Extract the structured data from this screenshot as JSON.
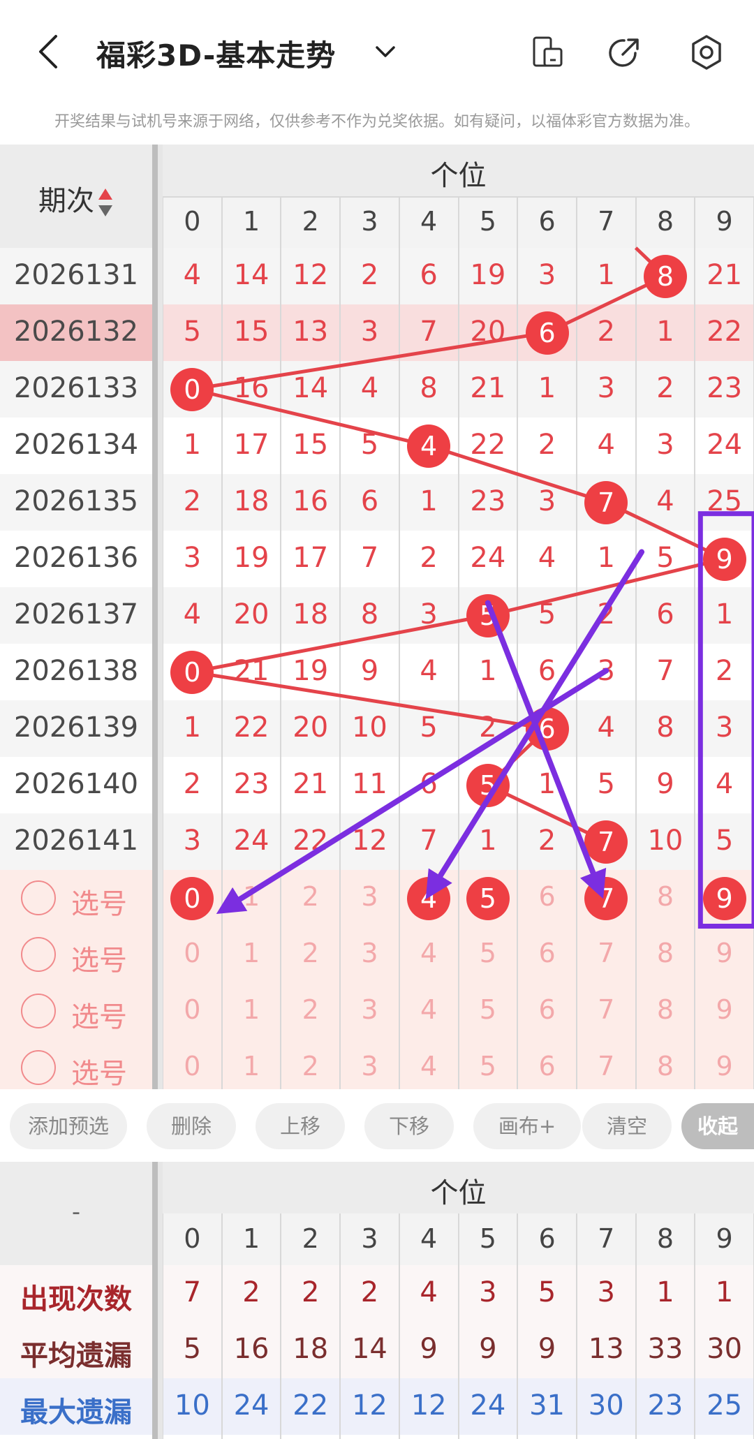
{
  "header": {
    "title": "福彩3D-基本走势",
    "back_icon": "chevron-left-icon",
    "title_dropdown_icon": "chevron-down-icon",
    "icons": [
      "phone-icon",
      "share-icon",
      "settings-icon"
    ]
  },
  "disclaimer": "开奖结果与试机号来源于网络，仅供参考不作为兑奖依据。如有疑问，以福体彩官方数据为准。",
  "grid": {
    "period_header": "期次",
    "section_title": "个位",
    "digits": [
      "0",
      "1",
      "2",
      "3",
      "4",
      "5",
      "6",
      "7",
      "8",
      "9"
    ],
    "rows": [
      {
        "period": "2026131",
        "cells": [
          "4",
          "14",
          "12",
          "2",
          "6",
          "19",
          "3",
          "1",
          "8",
          "21"
        ],
        "win": 8
      },
      {
        "period": "2026132",
        "cells": [
          "5",
          "15",
          "13",
          "3",
          "7",
          "20",
          "6",
          "2",
          "1",
          "22"
        ],
        "win": 6
      },
      {
        "period": "2026133",
        "cells": [
          "0",
          "16",
          "14",
          "4",
          "8",
          "21",
          "1",
          "3",
          "2",
          "23"
        ],
        "win": 0
      },
      {
        "period": "2026134",
        "cells": [
          "1",
          "17",
          "15",
          "5",
          "4",
          "22",
          "2",
          "4",
          "3",
          "24"
        ],
        "win": 4
      },
      {
        "period": "2026135",
        "cells": [
          "2",
          "18",
          "16",
          "6",
          "1",
          "23",
          "3",
          "7",
          "4",
          "25"
        ],
        "win": 7
      },
      {
        "period": "2026136",
        "cells": [
          "3",
          "19",
          "17",
          "7",
          "2",
          "24",
          "4",
          "1",
          "5",
          "9"
        ],
        "win": 9
      },
      {
        "period": "2026137",
        "cells": [
          "4",
          "20",
          "18",
          "8",
          "3",
          "5",
          "5",
          "2",
          "6",
          "1"
        ],
        "win": 5
      },
      {
        "period": "2026138",
        "cells": [
          "0",
          "21",
          "19",
          "9",
          "4",
          "1",
          "6",
          "3",
          "7",
          "2"
        ],
        "win": 0
      },
      {
        "period": "2026139",
        "cells": [
          "1",
          "22",
          "20",
          "10",
          "5",
          "2",
          "6",
          "4",
          "8",
          "3"
        ],
        "win": 6
      },
      {
        "period": "2026140",
        "cells": [
          "2",
          "23",
          "21",
          "11",
          "6",
          "5",
          "1",
          "5",
          "9",
          "4"
        ],
        "win": 5
      },
      {
        "period": "2026141",
        "cells": [
          "3",
          "24",
          "22",
          "12",
          "7",
          "1",
          "2",
          "7",
          "10",
          "5"
        ],
        "win": 7
      }
    ],
    "pick_label": "选号",
    "pick_rows": [
      {
        "selected": [
          0,
          4,
          5,
          7,
          9
        ]
      },
      {
        "selected": []
      },
      {
        "selected": []
      },
      {
        "selected": []
      }
    ]
  },
  "toolbar": {
    "buttons": [
      "添加预选",
      "删除",
      "上移",
      "下移",
      "画布+",
      "清空",
      "收起"
    ]
  },
  "stats": {
    "corner": "-",
    "section_title": "个位",
    "rows": [
      {
        "label": "出现次数",
        "values": [
          "7",
          "2",
          "2",
          "2",
          "4",
          "3",
          "5",
          "3",
          "1",
          "1"
        ],
        "color": "#a8252b"
      },
      {
        "label": "平均遗漏",
        "values": [
          "5",
          "16",
          "18",
          "14",
          "9",
          "9",
          "9",
          "13",
          "33",
          "30"
        ],
        "color": "#7a2e2e"
      },
      {
        "label": "最大遗漏",
        "values": [
          "10",
          "24",
          "22",
          "12",
          "12",
          "24",
          "31",
          "30",
          "23",
          "25"
        ],
        "color": "#3a6fc8"
      }
    ]
  },
  "colors": {
    "ball": "#ee3f44",
    "number": "#e4434a",
    "annotation": "#7b2ee0",
    "trend_line": "#e4434a"
  }
}
